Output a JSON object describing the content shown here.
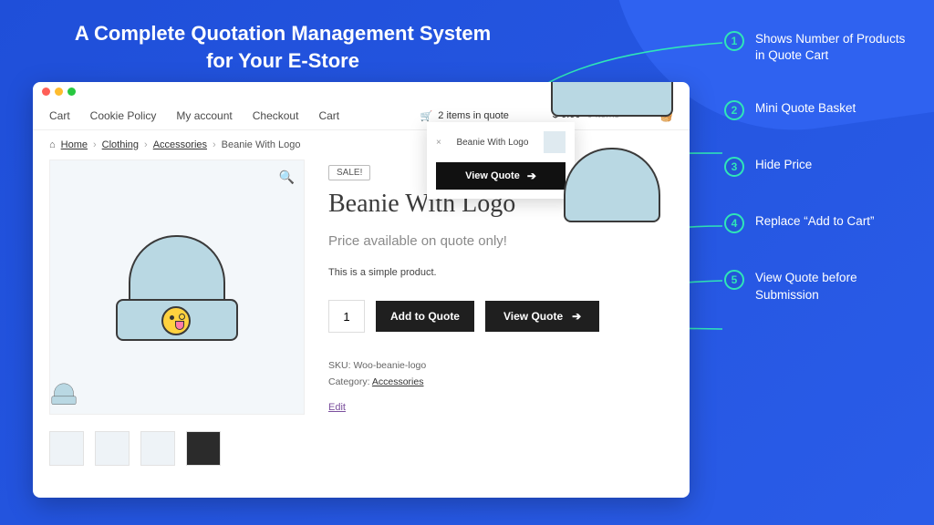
{
  "banner": {
    "title": "A Complete Quotation Management System for Your E-Store"
  },
  "nav": {
    "items": [
      "Cart",
      "Cookie Policy",
      "My account",
      "Checkout",
      "Cart"
    ]
  },
  "quote_status": {
    "text": "2 items in quote"
  },
  "cart_status": {
    "amount": "$ 0.00",
    "items": "0 items"
  },
  "breadcrumb": {
    "home_icon": "⌂",
    "items": [
      "Home",
      "Clothing",
      "Accessories"
    ],
    "current": "Beanie With Logo"
  },
  "mini_quote": {
    "product_name": "Beanie With Logo",
    "button_label": "View Quote"
  },
  "product": {
    "sale_label": "SALE!",
    "title": "Beanie With Logo",
    "price_message": "Price available on quote only!",
    "description": "This is a simple product.",
    "qty": "1",
    "add_to_quote": "Add to Quote",
    "view_quote": "View Quote",
    "sku_label": "SKU:",
    "sku": "Woo-beanie-logo",
    "category_label": "Category:",
    "category": "Accessories",
    "edit": "Edit"
  },
  "annotations": [
    {
      "n": "1",
      "text": "Shows Number of Products in Quote Cart"
    },
    {
      "n": "2",
      "text": "Mini Quote Basket"
    },
    {
      "n": "3",
      "text": "Hide Price"
    },
    {
      "n": "4",
      "text": "Replace “Add to Cart”"
    },
    {
      "n": "5",
      "text": "View Quote before Submission"
    }
  ]
}
